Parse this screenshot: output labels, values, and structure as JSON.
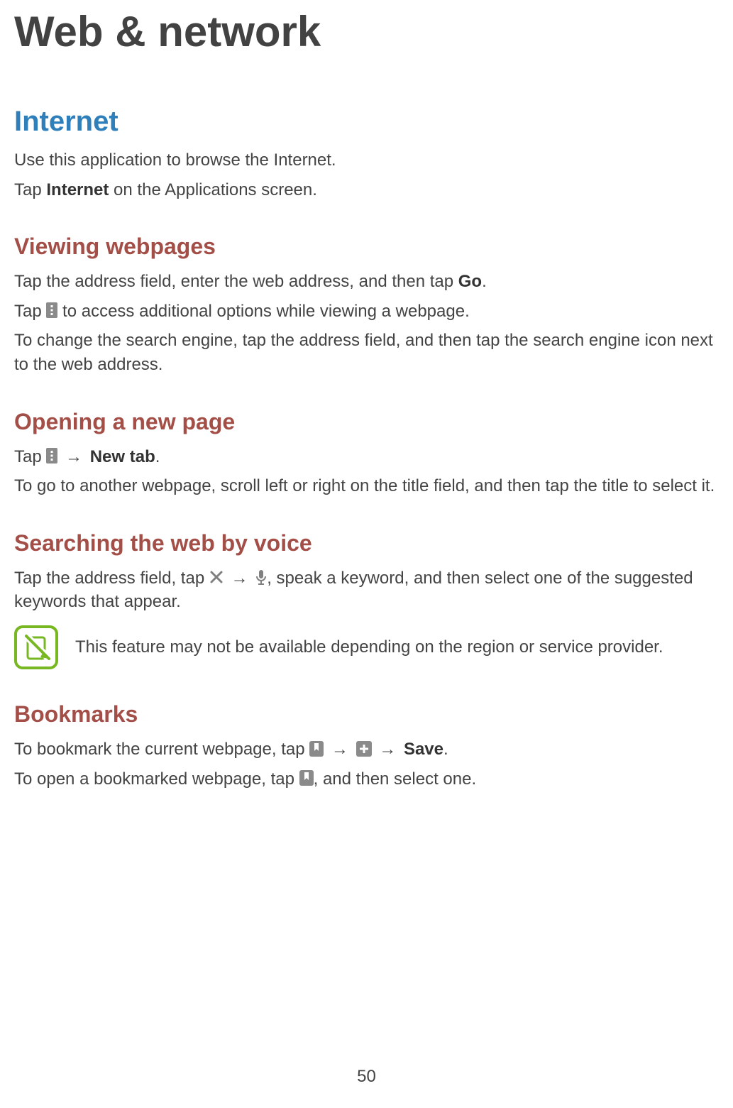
{
  "page": {
    "title": "Web & network",
    "number": "50"
  },
  "internet": {
    "heading": "Internet",
    "p1": "Use this application to browse the Internet.",
    "p2_pre": "Tap ",
    "p2_bold": "Internet",
    "p2_post": " on the Applications screen."
  },
  "viewing": {
    "heading": "Viewing webpages",
    "p1_pre": "Tap the address field, enter the web address, and then tap ",
    "p1_bold": "Go",
    "p1_post": ".",
    "p2_pre": "Tap ",
    "p2_post": " to access additional options while viewing a webpage.",
    "p3": "To change the search engine, tap the address field, and then tap the search engine icon next to the web address."
  },
  "opening": {
    "heading": "Opening a new page",
    "p1_pre": "Tap ",
    "p1_arrow": " → ",
    "p1_bold": "New tab",
    "p1_post": ".",
    "p2": "To go to another webpage, scroll left or right on the title field, and then tap the title to select it."
  },
  "voice": {
    "heading": "Searching the web by voice",
    "p1_pre": "Tap the address field, tap ",
    "p1_arrow": " → ",
    "p1_post": ", speak a keyword, and then select one of the suggested keywords that appear.",
    "note": "This feature may not be available depending on the region or service provider."
  },
  "bookmarks": {
    "heading": "Bookmarks",
    "p1_pre": "To bookmark the current webpage, tap ",
    "p1_arrow1": " → ",
    "p1_arrow2": " → ",
    "p1_bold": "Save",
    "p1_post": ".",
    "p2_pre": "To open a bookmarked webpage, tap ",
    "p2_post": ", and then select one."
  }
}
